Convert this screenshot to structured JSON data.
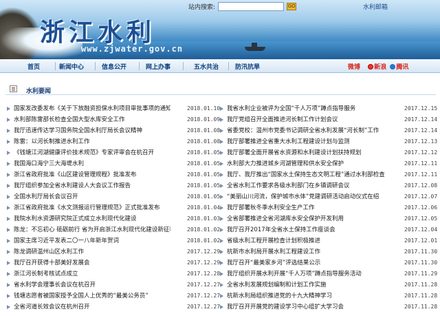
{
  "header": {
    "title": "浙江水利",
    "domain": "www.zjwater.gov.cn",
    "search_label": "站内搜索:",
    "search_placeholder": "",
    "search_button": "GO",
    "mail_link": "水利邮箱"
  },
  "nav": {
    "items": [
      "首页",
      "新闻中心",
      "信息公开",
      "网上办事",
      "五水共治",
      "防汛抗旱"
    ],
    "weibo_label": "微博",
    "sina_label": "新浪",
    "tencent_label": "腾讯"
  },
  "section": {
    "title": "水利要闻"
  },
  "news_left": [
    {
      "title": "国家发改委发布《关于下放融资担保水利项目审批事项的通知》",
      "date": "2018.01.10"
    },
    {
      "title": "水利部陈雷部长检查全国大型水库安全工作",
      "date": "2018.01.09"
    },
    {
      "title": "我厅迅速传达学习国务院全国水利厅局长会议精神",
      "date": "2018.01.08"
    },
    {
      "title": "陈雷：以河长制推进水利工作",
      "date": "2018.01.08"
    },
    {
      "title": "《钱塘江河湖健康评价技术规范》专家评审会在杭召开",
      "date": "2018.01.05"
    },
    {
      "title": "我国海口海宁三大海堤水利",
      "date": "2018.01.05"
    },
    {
      "title": "浙江省政府批准《山区建设管理规程》批准发布",
      "date": "2018.01.05"
    },
    {
      "title": "我厅组织参加全省水利建设人大会议工作报告",
      "date": "2018.01.05"
    },
    {
      "title": "全国水利厅局长会议召开",
      "date": "2018.01.05"
    },
    {
      "title": "浙江省政府批准《水文测报运行管理规范》正式批准发布",
      "date": "2018.01.04"
    },
    {
      "title": "我院水利水资源研究院正式成立水利现代化建设",
      "date": "2018.01.03"
    },
    {
      "title": "陈龙：不忘初心 砥砺前行 省为开启浙江水利现代化建设新征程",
      "date": "2018.01.02"
    },
    {
      "title": "国家主席习近平发表二〇一八年新年贺词",
      "date": "2018.01.02"
    },
    {
      "title": "陈龙调研温州山区水利工作",
      "date": "2017.12.29"
    },
    {
      "title": "我厅召开获得十部美好发展会",
      "date": "2017.12.29"
    },
    {
      "title": "浙江河长制考核试点成立",
      "date": "2017.12.28"
    },
    {
      "title": "省水利学会理事长会议在杭召开",
      "date": "2017.12.27"
    },
    {
      "title": "钱塘志愿者被国家授予全国人上优秀的“最美公务员”",
      "date": "2017.12.27"
    },
    {
      "title": "全省河道长效会议在杭州召开",
      "date": "2017.12.27"
    }
  ],
  "news_right": [
    {
      "title": "我省水利企业被评为全国“千人万项”蹲点指导服务",
      "date": "2017.12.15"
    },
    {
      "title": "我厅党组召开全面推进河长制工作计划会议",
      "date": "2017.12.14"
    },
    {
      "title": "省委党校：温州市党委书记调研全省水利发展“河长制”工作",
      "date": "2017.12.14"
    },
    {
      "title": "我厅部署推进全省重大水利工程建设计划与监测",
      "date": "2017.12.13"
    },
    {
      "title": "我厅部署全面开展省水资源和水利建设计划扶持规划",
      "date": "2017.12.12"
    },
    {
      "title": "水利部大力推进城乡河湖管理和供水安全保护",
      "date": "2017.12.11"
    },
    {
      "title": "我厅、我厅推出“国家水土保持生态文明工程”通过水利部检查",
      "date": "2017.12.11"
    },
    {
      "title": "全省水利工作要求各级水利部门在乡镇调研会议",
      "date": "2017.12.08"
    },
    {
      "title": "“美丽山川河流，保护城市水体”党建调研活动启动仪式在绍",
      "date": "2017.12.07"
    },
    {
      "title": "我厅部署秋冬季水利安全生产工作",
      "date": "2017.12.06"
    },
    {
      "title": "全省部署推进全省河湖库水安全保护开发利用",
      "date": "2017.12.05"
    },
    {
      "title": "我厅召开2017年全省水土保持工作座谈会",
      "date": "2017.12.04"
    },
    {
      "title": "省级水利工程开展检查计划积极推进",
      "date": "2017.12.01"
    },
    {
      "title": "杭新市水利局开展水利工程建设工作",
      "date": "2017.11.30"
    },
    {
      "title": "我厅召开“最美家乡河”评选结果公示",
      "date": "2017.11.30"
    },
    {
      "title": "我厅组织开展水利开展“千人万项”蹲点指导服务活动",
      "date": "2017.11.29"
    },
    {
      "title": "全省水利发展规划编制和计划工作实施",
      "date": "2017.11.28"
    },
    {
      "title": "杭新水利局组织推进党的十九大精神学习",
      "date": "2017.11.28"
    },
    {
      "title": "我厅召开开展党的建设学习中心组扩大学习会",
      "date": "2017.11.28"
    }
  ]
}
